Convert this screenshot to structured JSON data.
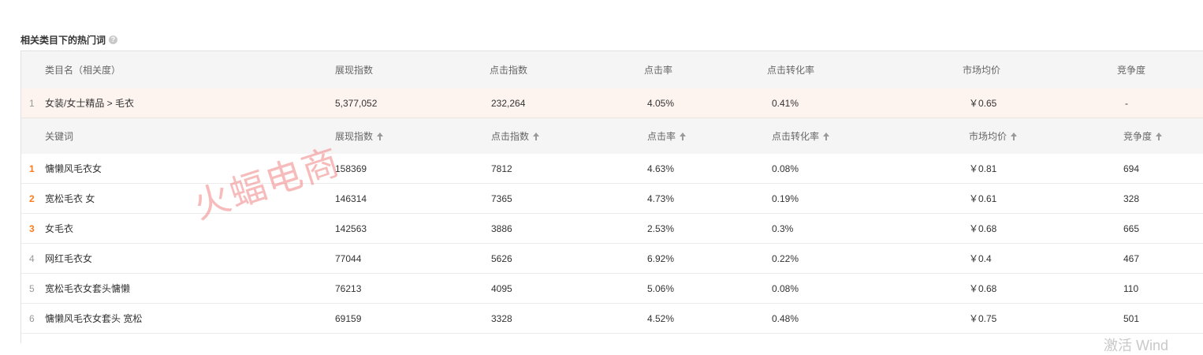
{
  "section": {
    "title": "相关类目下的热门词",
    "help_icon": "?"
  },
  "category_header": [
    "类目名（相关度）",
    "展现指数",
    "点击指数",
    "点击率",
    "点击转化率",
    "市场均价",
    "竞争度"
  ],
  "category_row": {
    "rank": "1",
    "name": "女装/女士精品 > 毛衣",
    "impressions": "5,377,052",
    "clicks": "232,264",
    "ctr": "4.05%",
    "cvr": "0.41%",
    "avg_price": "￥0.65",
    "competition": "-"
  },
  "keyword_header": [
    "关键词",
    "展现指数",
    "点击指数",
    "点击率",
    "点击转化率",
    "市场均价",
    "竞争度"
  ],
  "keywords": [
    {
      "rank": "1",
      "keyword": "慵懒风毛衣女",
      "impressions": "158369",
      "clicks": "7812",
      "ctr": "4.63%",
      "cvr": "0.08%",
      "avg_price": "￥0.81",
      "competition": "694"
    },
    {
      "rank": "2",
      "keyword": "宽松毛衣 女",
      "impressions": "146314",
      "clicks": "7365",
      "ctr": "4.73%",
      "cvr": "0.19%",
      "avg_price": "￥0.61",
      "competition": "328"
    },
    {
      "rank": "3",
      "keyword": "女毛衣",
      "impressions": "142563",
      "clicks": "3886",
      "ctr": "2.53%",
      "cvr": "0.3%",
      "avg_price": "￥0.68",
      "competition": "665"
    },
    {
      "rank": "4",
      "keyword": "网红毛衣女",
      "impressions": "77044",
      "clicks": "5626",
      "ctr": "6.92%",
      "cvr": "0.22%",
      "avg_price": "￥0.4",
      "competition": "467"
    },
    {
      "rank": "5",
      "keyword": "宽松毛衣女套头慵懒",
      "impressions": "76213",
      "clicks": "4095",
      "ctr": "5.06%",
      "cvr": "0.08%",
      "avg_price": "￥0.68",
      "competition": "110"
    },
    {
      "rank": "6",
      "keyword": "慵懒风毛衣女套头 宽松",
      "impressions": "69159",
      "clicks": "3328",
      "ctr": "4.52%",
      "cvr": "0.48%",
      "avg_price": "￥0.75",
      "competition": "501"
    }
  ],
  "watermark": "火蝠电商",
  "corner_text": "激活 Wind",
  "colors": {
    "top_rank": "#ff7a1a",
    "category_row_bg": "#fdf4ef",
    "header_bg": "#f5f5f5"
  }
}
